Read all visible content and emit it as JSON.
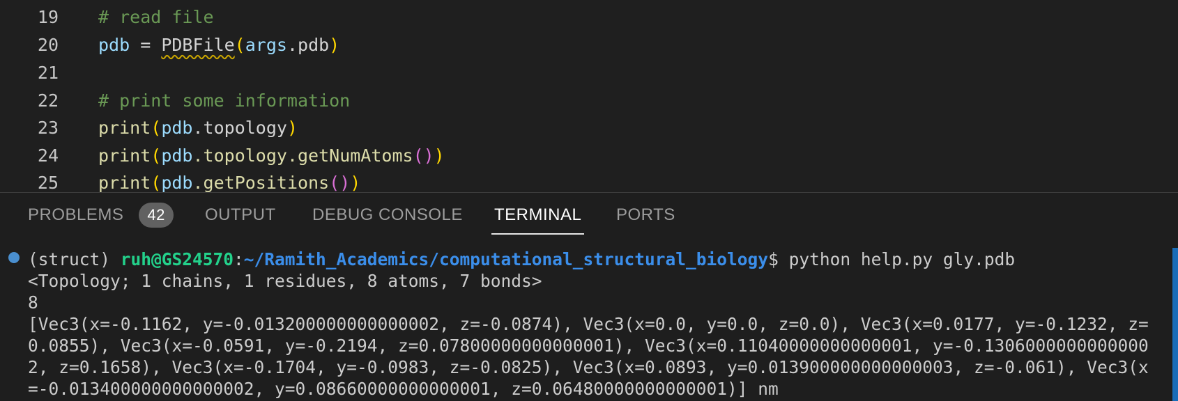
{
  "editor": {
    "lines": [
      {
        "num": "19",
        "comment": "# read file"
      },
      {
        "num": "20",
        "var": "pdb",
        "eq": " = ",
        "cls": "PDBFile",
        "open": "(",
        "arg": "args",
        "dot": ".",
        "attr": "pdb",
        "close": ")"
      },
      {
        "num": "21"
      },
      {
        "num": "22",
        "comment": "# print some information"
      },
      {
        "num": "23",
        "fn": "print",
        "open": "(",
        "var": "pdb",
        "rest": ".topology",
        "close": ")"
      },
      {
        "num": "24",
        "fn": "print",
        "open": "(",
        "var": "pdb",
        "rest": ".topology.getNumAtoms",
        "inner": "()",
        "close": ")"
      },
      {
        "num": "25",
        "fn": "print",
        "open": "(",
        "var": "pdb",
        "rest": ".getPositions",
        "inner": "()",
        "close": ")"
      }
    ]
  },
  "panel": {
    "tabs": [
      {
        "label": "PROBLEMS",
        "badge": "42"
      },
      {
        "label": "OUTPUT"
      },
      {
        "label": "DEBUG CONSOLE"
      },
      {
        "label": "TERMINAL",
        "active": true
      },
      {
        "label": "PORTS"
      }
    ]
  },
  "terminal": {
    "prompt_env": "(struct) ",
    "prompt_user": "ruh@GS24570",
    "prompt_sep": ":",
    "prompt_path": "~/Ramith_Academics/computational_structural_biology",
    "prompt_cmd": "$ python help.py gly.pdb",
    "output": [
      "<Topology; 1 chains, 1 residues, 8 atoms, 7 bonds>",
      "8",
      "[Vec3(x=-0.1162, y=-0.013200000000000002, z=-0.0874), Vec3(x=0.0, y=0.0, z=0.0), Vec3(x=0.0177, y=-0.1232, z=",
      "0.0855), Vec3(x=-0.0591, y=-0.2194, z=0.07800000000000001), Vec3(x=0.11040000000000001, y=-0.1306000000000000",
      "2, z=0.1658), Vec3(x=-0.1704, y=-0.0983, z=-0.0825), Vec3(x=0.0893, y=0.013900000000000003, z=-0.061), Vec3(x",
      "=-0.013400000000000002, y=0.08660000000000001, z=0.06480000000000001)] nm"
    ]
  },
  "colors": {
    "comment": "#6a9955",
    "variable": "#9cdcfe",
    "function": "#dcdcaa",
    "bracket1": "#ffd700",
    "bracket2": "#da70d6",
    "user": "#23d18b",
    "path": "#3b8eea"
  }
}
